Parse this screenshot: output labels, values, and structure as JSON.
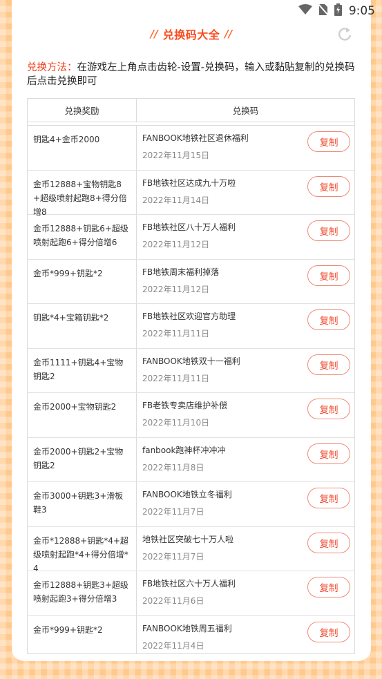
{
  "status_bar": {
    "time": "9:05"
  },
  "header": {
    "title": "兑换码大全",
    "slash_left": "//",
    "slash_right": "//"
  },
  "method": {
    "label": "兑换方法：",
    "text": "在游戏左上角点击齿轮-设置-兑换码，输入或黏贴复制的兑换码后点击兑换即可"
  },
  "table": {
    "headers": {
      "reward": "兑换奖励",
      "code": "兑换码"
    },
    "copy_label": "复制",
    "rows": [
      {
        "reward": "钥匙4+金币2000",
        "code": "FANBOOK地铁社区退休福利",
        "date": "2022年11月15日"
      },
      {
        "reward": "金币12888+宝物钥匙8+超级喷射起跑8+得分倍增8",
        "code": "FB地铁社区达成九十万啦",
        "date": "2022年11月14日"
      },
      {
        "reward": "金币12888+钥匙6+超级喷射起跑6+得分倍增6",
        "code": "FB地铁社区八十万人福利",
        "date": "2022年11月12日"
      },
      {
        "reward": "金币*999+钥匙*2",
        "code": "FB地铁周末福利掉落",
        "date": "2022年11月12日"
      },
      {
        "reward": "钥匙*4+宝箱钥匙*2",
        "code": "FB地铁社区欢迎官方助理",
        "date": "2022年11月11日"
      },
      {
        "reward": "金币1111+钥匙4+宝物钥匙2",
        "code": "FANBOOK地铁双十一福利",
        "date": "2022年11月11日"
      },
      {
        "reward": "金币2000+宝物钥匙2",
        "code": "FB老铁专卖店维护补偿",
        "date": "2022年11月10日"
      },
      {
        "reward": "金币2000+钥匙2+宝物钥匙2",
        "code": "fanbook跑神杯冲冲冲",
        "date": "2022年11月8日"
      },
      {
        "reward": "金币3000+钥匙3+滑板鞋3",
        "code": "FANBOOK地铁立冬福利",
        "date": "2022年11月7日"
      },
      {
        "reward": "金币*12888+钥匙*4+超级喷射起跑*4+得分倍增*4",
        "code": "地铁社区突破七十万人啦",
        "date": "2022年11月7日"
      },
      {
        "reward": "金币12888+钥匙3+超级喷射起跑3+得分倍增3",
        "code": "FB地铁社区六十万人福利",
        "date": "2022年11月6日"
      },
      {
        "reward": "金币*999+钥匙*2",
        "code": "FANBOOK地铁周五福利",
        "date": "2022年11月4日"
      }
    ]
  },
  "colors": {
    "accent": "#fa4b1e",
    "background": "#ffc98e",
    "button_border": "#f08a78"
  },
  "icons": [
    "wifi-icon",
    "no-sim-icon",
    "battery-icon",
    "refresh-icon"
  ]
}
